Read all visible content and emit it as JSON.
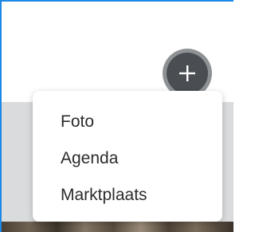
{
  "fab": {
    "icon": "plus-icon"
  },
  "menu": {
    "items": [
      {
        "label": "Foto"
      },
      {
        "label": "Agenda"
      },
      {
        "label": "Marktplaats"
      }
    ]
  },
  "colors": {
    "border_accent": "#1e88e5",
    "fab_ring": "#8f9295",
    "fab_fill": "#4a4e53",
    "panel_bg": "#dadbdd",
    "menu_text": "#2b2b2b"
  }
}
